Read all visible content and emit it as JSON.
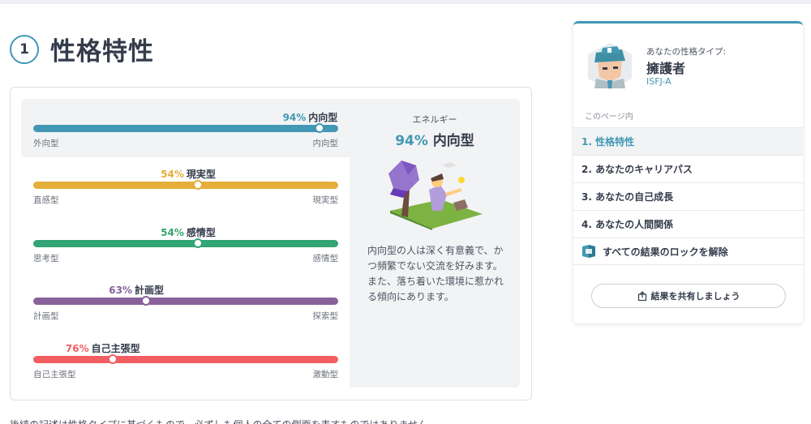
{
  "section": {
    "number": "1",
    "title": "性格特性"
  },
  "traits": [
    {
      "pct": "94%",
      "name": "内向型",
      "value": 0.94,
      "left_pole": "外向型",
      "right_pole": "内向型",
      "color": "#4298b4"
    },
    {
      "pct": "54%",
      "name": "現実型",
      "value": 0.54,
      "left_pole": "直感型",
      "right_pole": "現実型",
      "color": "#e4ae3a"
    },
    {
      "pct": "54%",
      "name": "感情型",
      "value": 0.54,
      "left_pole": "思考型",
      "right_pole": "感情型",
      "color": "#33a474"
    },
    {
      "pct": "63%",
      "name": "計画型",
      "value": 0.37,
      "left_pole": "計画型",
      "right_pole": "探索型",
      "color": "#88619a"
    },
    {
      "pct": "76%",
      "name": "自己主張型",
      "value": 0.26,
      "left_pole": "自己主張型",
      "right_pole": "激動型",
      "color": "#f25e62"
    }
  ],
  "detail": {
    "label": "エネルギー",
    "pct": "94%",
    "name": "内向型",
    "description": "内向型の人は深く有意義で、かつ頻繁でない交流を好みます。また、落ち着いた環境に惹かれる傾向にあります。"
  },
  "sidebar": {
    "type_caption": "あなたの性格タイプ:",
    "type_name": "擁護者",
    "type_code": "ISFJ-A",
    "toc_caption": "このページ内",
    "toc": [
      "1. 性格特性",
      "2. あなたのキャリアパス",
      "3. あなたの自己成長",
      "4. あなたの人間関係"
    ],
    "unlock_label": "すべての結果のロックを解除",
    "share_label": "結果を共有しましょう"
  },
  "icons": {
    "unlock": "puzzle-icon",
    "share": "share-icon",
    "avatar": "isfj-avatar"
  },
  "bottom_text": "後続の記述は性格タイプに基づくもので、必ずしも個人の全ての側面を表すものではありません。"
}
